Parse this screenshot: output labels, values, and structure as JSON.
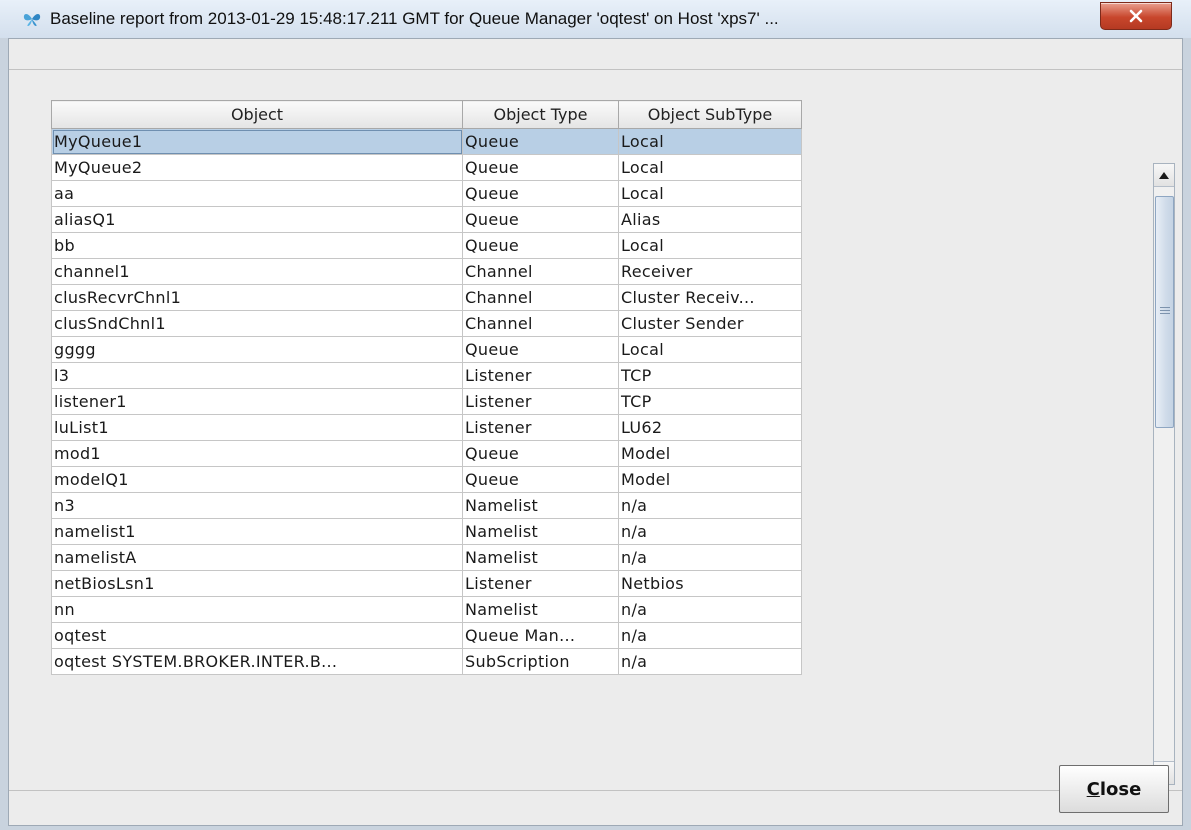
{
  "window": {
    "title": "Baseline report from 2013-01-29 15:48:17.211 GMT for Queue Manager 'oqtest' on Host 'xps7'  ...",
    "close_icon": "x-icon"
  },
  "table": {
    "columns": [
      "Object",
      "Object Type",
      "Object SubType"
    ],
    "selected_row": 0,
    "rows": [
      [
        "MyQueue1",
        "Queue",
        "Local"
      ],
      [
        "MyQueue2",
        "Queue",
        "Local"
      ],
      [
        "aa",
        "Queue",
        "Local"
      ],
      [
        "aliasQ1",
        "Queue",
        "Alias"
      ],
      [
        "bb",
        "Queue",
        "Local"
      ],
      [
        "channel1",
        "Channel",
        "Receiver"
      ],
      [
        "clusRecvrChnl1",
        "Channel",
        "Cluster Receiv..."
      ],
      [
        "clusSndChnl1",
        "Channel",
        "Cluster Sender"
      ],
      [
        "gggg",
        "Queue",
        "Local"
      ],
      [
        "l3",
        "Listener",
        "TCP"
      ],
      [
        "listener1",
        "Listener",
        "TCP"
      ],
      [
        "luList1",
        "Listener",
        "LU62"
      ],
      [
        "mod1",
        "Queue",
        "Model"
      ],
      [
        "modelQ1",
        "Queue",
        "Model"
      ],
      [
        "n3",
        "Namelist",
        "n/a"
      ],
      [
        "namelist1",
        "Namelist",
        "n/a"
      ],
      [
        "namelistA",
        "Namelist",
        "n/a"
      ],
      [
        "netBiosLsn1",
        "Listener",
        "Netbios"
      ],
      [
        "nn",
        "Namelist",
        "n/a"
      ],
      [
        "oqtest",
        "Queue Man...",
        "n/a"
      ],
      [
        "oqtest SYSTEM.BROKER.INTER.B...",
        "SubScription",
        "n/a"
      ]
    ]
  },
  "scrollbar": {
    "up_icon": "arrow-up-icon",
    "down_icon": "arrow-down-icon",
    "position": 0.0,
    "visible_fraction": 0.37
  },
  "buttons": {
    "close_mnemonic": "C",
    "close_rest": "lose"
  }
}
